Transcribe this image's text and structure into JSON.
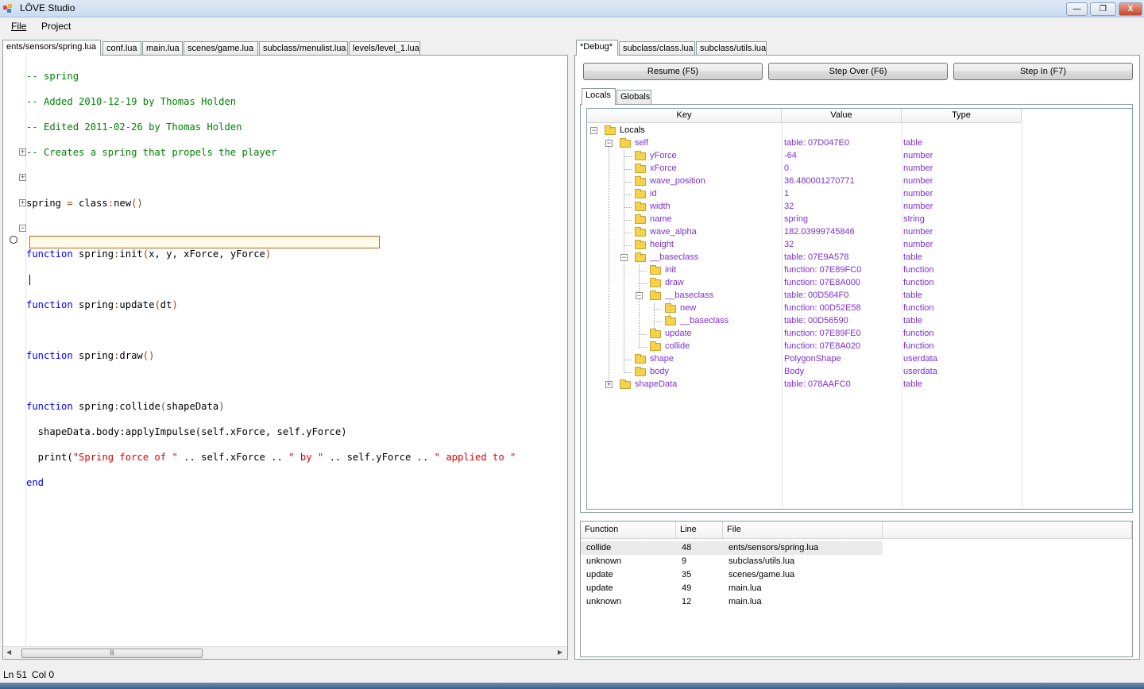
{
  "window": {
    "title": "LÖVE Studio",
    "minimize": "—",
    "maximize": "❐",
    "close": "X"
  },
  "menu": [
    "File",
    "Project"
  ],
  "editor_tabs": [
    "ents/sensors/spring.lua",
    "conf.lua",
    "main.lua",
    "scenes/game.lua",
    "subclass/menulist.lua",
    "levels/level_1.lua"
  ],
  "code": {
    "l1": "-- spring",
    "l2": "-- Added 2010-12-19 by Thomas Holden",
    "l3": "-- Edited 2011-02-26 by Thomas Holden",
    "l4": "-- Creates a spring that propels the player",
    "spring_assign": {
      "name": "spring",
      "eq": " = ",
      "class": "class",
      "colon": ":",
      "new": "new",
      "paren": "()"
    },
    "init": {
      "kw": "function",
      "name": " spring",
      "colon": ":",
      "fn": "init",
      "open": "(",
      "args": "x, y, xForce, yForce",
      "close": ")"
    },
    "update": {
      "kw": "function",
      "name": " spring",
      "colon": ":",
      "fn": "update",
      "open": "(",
      "args": "dt",
      "close": ")"
    },
    "draw": {
      "kw": "function",
      "name": " spring",
      "colon": ":",
      "fn": "draw",
      "open": "(",
      "args": "",
      "close": ")"
    },
    "collide": {
      "kw": "function",
      "name": " spring",
      "colon": ":",
      "fn": "collide",
      "open": "(",
      "args": "shapeData",
      "close": ")"
    },
    "impulse": "  shapeData.body:applyImpulse(self.xForce, self.yForce)",
    "print_a": "  print(",
    "print_str1": "\"Spring force of \"",
    "print_b": " .. self.xForce .. ",
    "print_str2": "\" by \"",
    "print_c": " .. self.yForce .. ",
    "print_str3": "\" applied to \"",
    "end": "end"
  },
  "status": {
    "ln": "Ln 51",
    "col": "Col 0"
  },
  "debug_tabs": [
    "*Debug*",
    "subclass/class.lua",
    "subclass/utils.lua"
  ],
  "buttons": {
    "resume": "Resume (F5)",
    "step_over": "Step Over (F6)",
    "step_in": "Step In (F7)"
  },
  "var_tabs": [
    "Locals",
    "Globals"
  ],
  "tree_columns": [
    "Key",
    "Value",
    "Type"
  ],
  "tree": [
    {
      "key": "Locals",
      "value": "",
      "type": ""
    },
    {
      "key": "self",
      "value": "table: 07D047E0",
      "type": "table"
    },
    {
      "key": "yForce",
      "value": "-64",
      "type": "number"
    },
    {
      "key": "xForce",
      "value": "0",
      "type": "number"
    },
    {
      "key": "wave_position",
      "value": "36.480001270771",
      "type": "number"
    },
    {
      "key": "id",
      "value": "1",
      "type": "number"
    },
    {
      "key": "width",
      "value": "32",
      "type": "number"
    },
    {
      "key": "name",
      "value": "spring",
      "type": "string"
    },
    {
      "key": "wave_alpha",
      "value": "182.03999745846",
      "type": "number"
    },
    {
      "key": "height",
      "value": "32",
      "type": "number"
    },
    {
      "key": "__baseclass",
      "value": "table: 07E9A578",
      "type": "table"
    },
    {
      "key": "init",
      "value": "function: 07E89FC0",
      "type": "function"
    },
    {
      "key": "draw",
      "value": "function: 07E8A000",
      "type": "function"
    },
    {
      "key": "__baseclass",
      "value": "table: 00D564F0",
      "type": "table"
    },
    {
      "key": "new",
      "value": "function: 00D52E58",
      "type": "function"
    },
    {
      "key": "__baseclass",
      "value": "table: 00D56590",
      "type": "table"
    },
    {
      "key": "update",
      "value": "function: 07E89FE0",
      "type": "function"
    },
    {
      "key": "collide",
      "value": "function: 07E8A020",
      "type": "function"
    },
    {
      "key": "shape",
      "value": "PolygonShape",
      "type": "userdata"
    },
    {
      "key": "body",
      "value": "Body",
      "type": "userdata"
    },
    {
      "key": "shapeData",
      "value": "table: 078AAFC0",
      "type": "table"
    }
  ],
  "tree_expanders": {
    "minus": "−",
    "plus": "+"
  },
  "stack_columns": [
    "Function",
    "Line",
    "File"
  ],
  "stack": [
    {
      "function": "collide",
      "line": "48",
      "file": "ents/sensors/spring.lua"
    },
    {
      "function": "unknown",
      "line": "9",
      "file": "subclass/utils.lua"
    },
    {
      "function": "update",
      "line": "35",
      "file": "scenes/game.lua"
    },
    {
      "function": "update",
      "line": "49",
      "file": "main.lua"
    },
    {
      "function": "unknown",
      "line": "12",
      "file": "main.lua"
    }
  ],
  "scroll": {
    "left": "◀",
    "right": "▶",
    "grip": "|||"
  },
  "colors": {
    "comment": "#008000",
    "keyword": "#0000ff",
    "string": "#e00000",
    "tree_text": "#7d2fd0"
  }
}
